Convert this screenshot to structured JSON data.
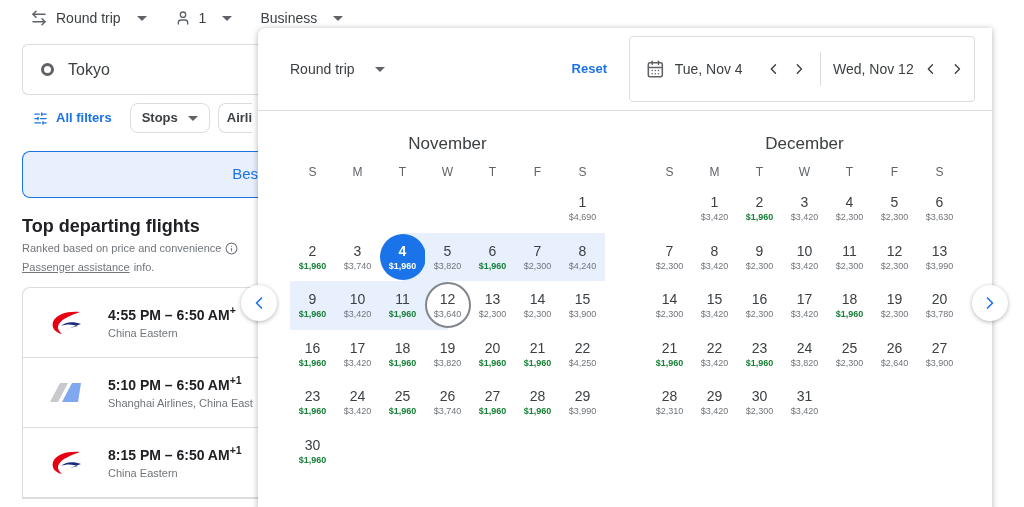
{
  "trip_bar": {
    "trip_type": "Round trip",
    "passengers": "1",
    "cabin": "Business"
  },
  "search": {
    "origin": "Tokyo"
  },
  "filters": {
    "all_filters": "All filters",
    "chips": [
      {
        "label": "Stops",
        "dropdown": true
      },
      {
        "label": "Airli",
        "dropdown": false
      }
    ]
  },
  "sort_tab": {
    "label": "Bes",
    "selected": true
  },
  "results": {
    "title": "Top departing flights",
    "subtitle": "Ranked based on price and convenience",
    "link": "Passenger assistance",
    "link_suffix": "info."
  },
  "flights": [
    {
      "times": "4:55 PM – 6:50 AM$^{+}$",
      "airline": "China Eastern",
      "kind": "swallow"
    },
    {
      "times": "5:10 PM – 6:50 AM$^{+1}$",
      "airline": "Shanghai Airlines, China East",
      "kind": "wing"
    },
    {
      "times": "8:15 PM – 6:50 AM$^{+1}$",
      "airline": "China Eastern",
      "kind": "swallow"
    }
  ],
  "date_picker": {
    "trip_type": "Round trip",
    "reset": "Reset",
    "depart": "Tue, Nov 4",
    "return": "Wed, Nov 12",
    "months": [
      {
        "name": "November",
        "weekdays": [
          "S",
          "M",
          "T",
          "W",
          "T",
          "F",
          "S"
        ],
        "weeks": [
          [
            {
              "kind": "blank"
            },
            {
              "kind": "blank"
            },
            {
              "kind": "blank"
            },
            {
              "kind": "blank"
            },
            {
              "kind": "blank"
            },
            {
              "kind": "blank"
            },
            {
              "kind": "day",
              "day": "1",
              "price": "$4,690",
              "low": false,
              "in_range": false
            }
          ],
          [
            {
              "kind": "day",
              "day": "2",
              "price": "$1,960",
              "low": true,
              "in_range": false
            },
            {
              "kind": "day",
              "day": "3",
              "price": "$3,740",
              "low": false,
              "in_range": false
            },
            {
              "kind": "depart",
              "day": "4",
              "price": "$1,960",
              "low": true,
              "in_range": true
            },
            {
              "kind": "day",
              "day": "5",
              "price": "$3,820",
              "low": false,
              "in_range": true
            },
            {
              "kind": "day",
              "day": "6",
              "price": "$1,960",
              "low": true,
              "in_range": true
            },
            {
              "kind": "day",
              "day": "7",
              "price": "$2,300",
              "low": false,
              "in_range": true
            },
            {
              "kind": "day",
              "day": "8",
              "price": "$4,240",
              "low": false,
              "in_range": true
            }
          ],
          [
            {
              "kind": "day",
              "day": "9",
              "price": "$1,960",
              "low": true,
              "in_range": true
            },
            {
              "kind": "day",
              "day": "10",
              "price": "$3,420",
              "low": false,
              "in_range": true
            },
            {
              "kind": "day",
              "day": "11",
              "price": "$1,960",
              "low": true,
              "in_range": true
            },
            {
              "kind": "return",
              "day": "12",
              "price": "$3,640",
              "low": false,
              "in_range": true
            },
            {
              "kind": "day",
              "day": "13",
              "price": "$2,300",
              "low": false,
              "in_range": false
            },
            {
              "kind": "day",
              "day": "14",
              "price": "$2,300",
              "low": false,
              "in_range": false
            },
            {
              "kind": "day",
              "day": "15",
              "price": "$3,900",
              "low": false,
              "in_range": false
            }
          ],
          [
            {
              "kind": "day",
              "day": "16",
              "price": "$1,960",
              "low": true,
              "in_range": false
            },
            {
              "kind": "day",
              "day": "17",
              "price": "$3,420",
              "low": false,
              "in_range": false
            },
            {
              "kind": "day",
              "day": "18",
              "price": "$1,960",
              "low": true,
              "in_range": false
            },
            {
              "kind": "day",
              "day": "19",
              "price": "$3,820",
              "low": false,
              "in_range": false
            },
            {
              "kind": "day",
              "day": "20",
              "price": "$1,960",
              "low": true,
              "in_range": false
            },
            {
              "kind": "day",
              "day": "21",
              "price": "$1,960",
              "low": true,
              "in_range": false
            },
            {
              "kind": "day",
              "day": "22",
              "price": "$4,250",
              "low": false,
              "in_range": false
            }
          ],
          [
            {
              "kind": "day",
              "day": "23",
              "price": "$1,960",
              "low": true,
              "in_range": false
            },
            {
              "kind": "day",
              "day": "24",
              "price": "$3,420",
              "low": false,
              "in_range": false
            },
            {
              "kind": "day",
              "day": "25",
              "price": "$1,960",
              "low": true,
              "in_range": false
            },
            {
              "kind": "day",
              "day": "26",
              "price": "$3,740",
              "low": false,
              "in_range": false
            },
            {
              "kind": "day",
              "day": "27",
              "price": "$1,960",
              "low": true,
              "in_range": false
            },
            {
              "kind": "day",
              "day": "28",
              "price": "$1,960",
              "low": true,
              "in_range": false
            },
            {
              "kind": "day",
              "day": "29",
              "price": "$3,990",
              "low": false,
              "in_range": false
            }
          ],
          [
            {
              "kind": "day",
              "day": "30",
              "price": "$1,960",
              "low": true,
              "in_range": false
            }
          ]
        ]
      },
      {
        "name": "December",
        "weekdays": [
          "S",
          "M",
          "T",
          "W",
          "T",
          "F",
          "S"
        ],
        "weeks": [
          [
            {
              "kind": "blank"
            },
            {
              "kind": "day",
              "day": "1",
              "price": "$3,420",
              "low": false,
              "in_range": false
            },
            {
              "kind": "day",
              "day": "2",
              "price": "$1,960",
              "low": true,
              "in_range": false
            },
            {
              "kind": "day",
              "day": "3",
              "price": "$3,420",
              "low": false,
              "in_range": false
            },
            {
              "kind": "day",
              "day": "4",
              "price": "$2,300",
              "low": false,
              "in_range": false
            },
            {
              "kind": "day",
              "day": "5",
              "price": "$2,300",
              "low": false,
              "in_range": false
            },
            {
              "kind": "day",
              "day": "6",
              "price": "$3,630",
              "low": false,
              "in_range": false
            }
          ],
          [
            {
              "kind": "day",
              "day": "7",
              "price": "$2,300",
              "low": false,
              "in_range": false
            },
            {
              "kind": "day",
              "day": "8",
              "price": "$3,420",
              "low": false,
              "in_range": false
            },
            {
              "kind": "day",
              "day": "9",
              "price": "$2,300",
              "low": false,
              "in_range": false
            },
            {
              "kind": "day",
              "day": "10",
              "price": "$3,420",
              "low": false,
              "in_range": false
            },
            {
              "kind": "day",
              "day": "11",
              "price": "$2,300",
              "low": false,
              "in_range": false
            },
            {
              "kind": "day",
              "day": "12",
              "price": "$2,300",
              "low": false,
              "in_range": false
            },
            {
              "kind": "day",
              "day": "13",
              "price": "$3,990",
              "low": false,
              "in_range": false
            }
          ],
          [
            {
              "kind": "day",
              "day": "14",
              "price": "$2,300",
              "low": false,
              "in_range": false
            },
            {
              "kind": "day",
              "day": "15",
              "price": "$3,420",
              "low": false,
              "in_range": false
            },
            {
              "kind": "day",
              "day": "16",
              "price": "$2,300",
              "low": false,
              "in_range": false
            },
            {
              "kind": "day",
              "day": "17",
              "price": "$3,420",
              "low": false,
              "in_range": false
            },
            {
              "kind": "day",
              "day": "18",
              "price": "$1,960",
              "low": true,
              "in_range": false
            },
            {
              "kind": "day",
              "day": "19",
              "price": "$2,300",
              "low": false,
              "in_range": false
            },
            {
              "kind": "day",
              "day": "20",
              "price": "$3,780",
              "low": false,
              "in_range": false
            }
          ],
          [
            {
              "kind": "day",
              "day": "21",
              "price": "$1,960",
              "low": true,
              "in_range": false
            },
            {
              "kind": "day",
              "day": "22",
              "price": "$3,420",
              "low": false,
              "in_range": false
            },
            {
              "kind": "day",
              "day": "23",
              "price": "$1,960",
              "low": true,
              "in_range": false
            },
            {
              "kind": "day",
              "day": "24",
              "price": "$3,820",
              "low": false,
              "in_range": false
            },
            {
              "kind": "day",
              "day": "25",
              "price": "$2,300",
              "low": false,
              "in_range": false
            },
            {
              "kind": "day",
              "day": "26",
              "price": "$2,640",
              "low": false,
              "in_range": false
            },
            {
              "kind": "day",
              "day": "27",
              "price": "$3,900",
              "low": false,
              "in_range": false
            }
          ],
          [
            {
              "kind": "day",
              "day": "28",
              "price": "$2,310",
              "low": false,
              "in_range": false
            },
            {
              "kind": "day",
              "day": "29",
              "price": "$3,420",
              "low": false,
              "in_range": false
            },
            {
              "kind": "day",
              "day": "30",
              "price": "$2,300",
              "low": false,
              "in_range": false
            },
            {
              "kind": "day",
              "day": "31",
              "price": "$3,420",
              "low": false,
              "in_range": false
            }
          ]
        ]
      }
    ]
  }
}
